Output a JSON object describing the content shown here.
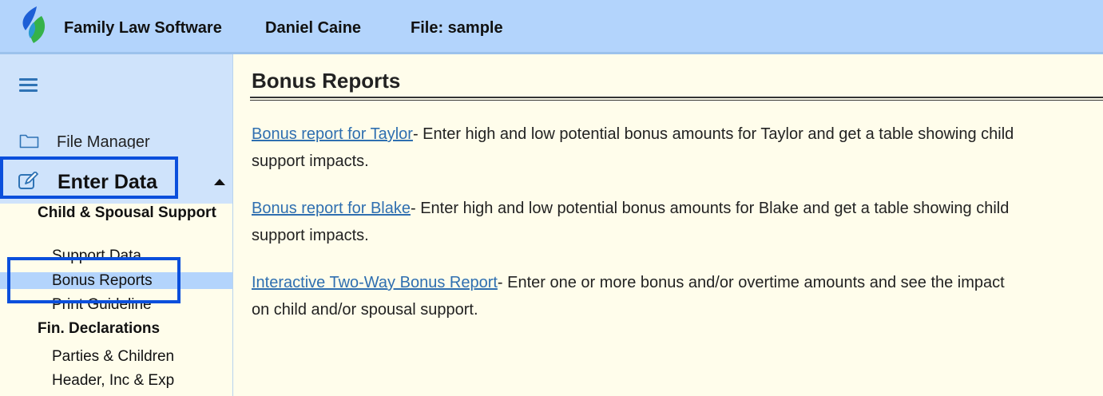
{
  "header": {
    "app_name": "Family Law Software",
    "user_name": "Daniel Caine",
    "file_label": "File: sample",
    "logo_icon": "leaf-logo-icon"
  },
  "sidebar": {
    "menu_icon": "hamburger-icon",
    "file_manager": {
      "label": "File Manager",
      "icon": "folder-icon"
    },
    "enter_data": {
      "label": "Enter Data",
      "icon": "edit-icon",
      "expanded": true
    },
    "sections": [
      {
        "title": "Child & Spousal Support",
        "items": [
          {
            "label": "Support Data"
          },
          {
            "label": "Bonus Reports",
            "selected": true
          },
          {
            "label": "Print Guideline"
          }
        ]
      },
      {
        "title": "Fin. Declarations",
        "items": [
          {
            "label": "Parties & Children"
          },
          {
            "label": "Header, Inc & Exp"
          }
        ]
      }
    ]
  },
  "main": {
    "title": "Bonus Reports",
    "entries": [
      {
        "link": "Bonus report for Taylor",
        "desc": "- Enter high and low potential bonus amounts for Taylor and get a table showing child support impacts."
      },
      {
        "link": "Bonus report for Blake",
        "desc": "- Enter high and low potential bonus amounts for Blake and get a table showing child support impacts."
      },
      {
        "link": "Interactive Two-Way Bonus Report",
        "desc": "- Enter one or more bonus and/or overtime amounts and see the impact on child and/or spousal support."
      }
    ]
  },
  "colors": {
    "header_bg": "#b3d4fc",
    "sidebar_bg": "#cfe3fb",
    "content_bg": "#fffdeb",
    "link": "#2f6fb0",
    "annotation_box": "#0b4fdc"
  }
}
